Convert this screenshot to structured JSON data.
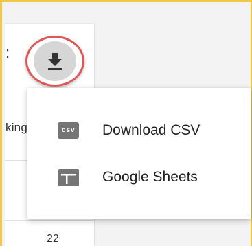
{
  "background": {
    "left_label_fragment": "king",
    "top_left_glyph": ":",
    "bottom_number_fragment": "22"
  },
  "download_button": {
    "icon": "download-icon"
  },
  "menu": {
    "items": [
      {
        "label": "Download CSV",
        "icon": "csv-icon",
        "icon_text": "csv"
      },
      {
        "label": "Google Sheets",
        "icon": "google-sheets-icon"
      }
    ]
  },
  "colors": {
    "frame": "#f2c744",
    "highlight_ring": "#e05555",
    "icon_gray": "#757575",
    "button_fill": "#d6d6d6"
  }
}
